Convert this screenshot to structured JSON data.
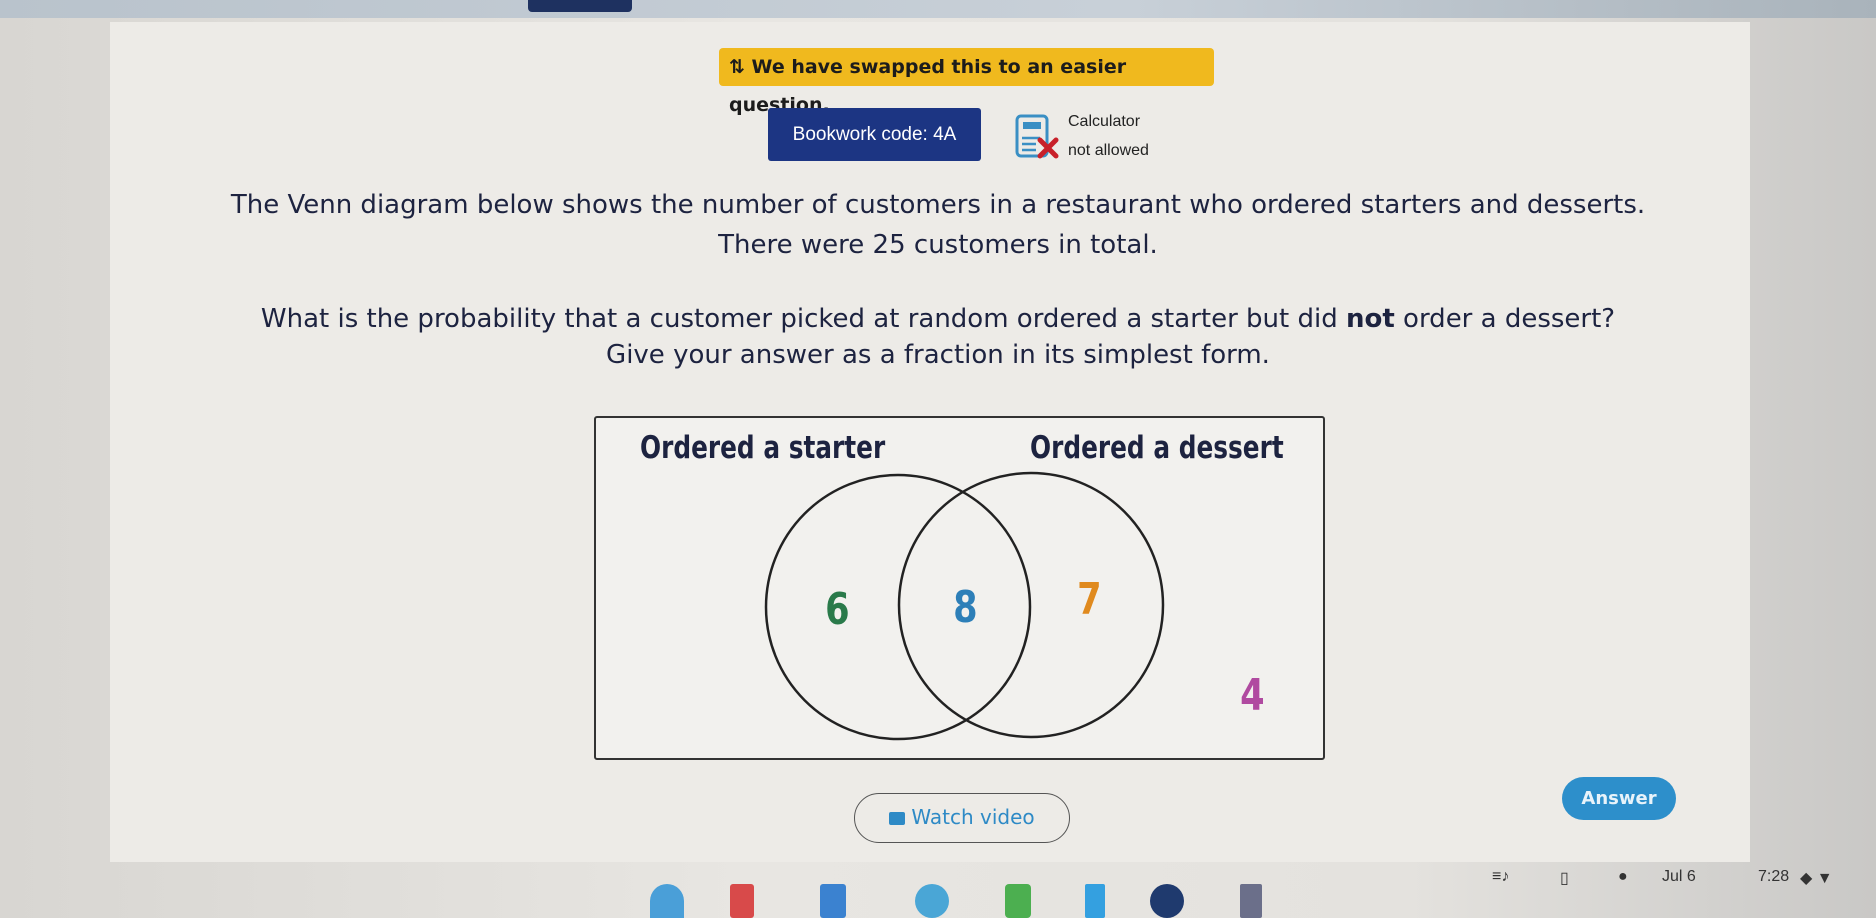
{
  "banner": {
    "icon": "swap-arrows-icon",
    "text": "We have swapped this to an easier question."
  },
  "bookwork": {
    "label": "Bookwork code: 4A"
  },
  "calculator": {
    "icon": "calculator-crossed-icon",
    "line1": "Calculator",
    "line2": "not allowed"
  },
  "question": {
    "line1": "The Venn diagram below shows the number of customers in a restaurant who ordered starters and desserts.",
    "line2": "There were 25 customers in total.",
    "line3_pre": "What is the probability that a customer picked at random ordered a starter but did ",
    "line3_bold": "not",
    "line3_post": " order a dessert?",
    "line4": "Give your answer as a fraction in its simplest form."
  },
  "venn": {
    "set_a": "Ordered a starter",
    "set_b": "Ordered a dessert",
    "only_a": "6",
    "both": "8",
    "only_b": "7",
    "neither": "4",
    "colors": {
      "only_a": "#2a7a4a",
      "both": "#2d7fb8",
      "only_b": "#e08a1e",
      "neither": "#b04aa0"
    }
  },
  "buttons": {
    "watch_video": "Watch video",
    "watch_icon": "video-camera-icon",
    "answer": "Answer"
  },
  "status": {
    "date": "Jul 6",
    "time": "7:28"
  },
  "colors": {
    "banner": "#f0b91e",
    "bookwork": "#1c3583",
    "accent": "#2d8fcb"
  }
}
